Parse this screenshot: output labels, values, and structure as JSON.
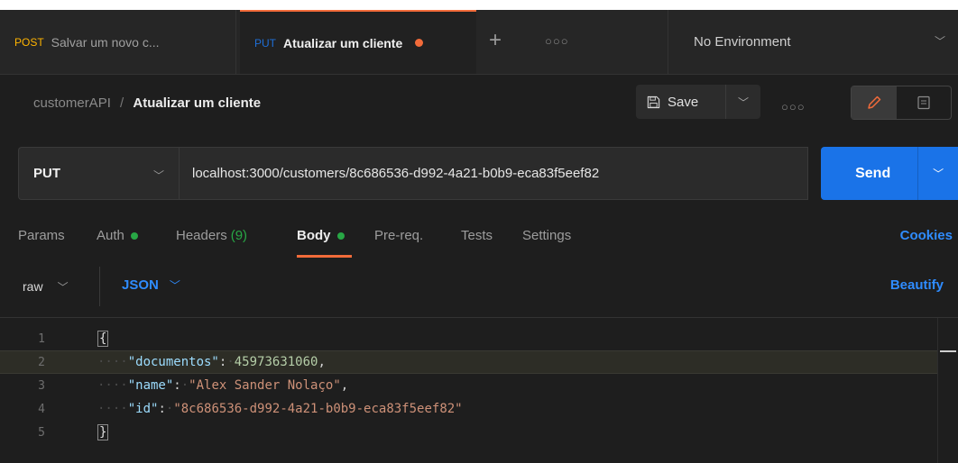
{
  "tabs": [
    {
      "method": "POST",
      "label": "Salvar um novo c..."
    },
    {
      "method": "PUT",
      "label": "Atualizar um cliente",
      "unsaved": true
    }
  ],
  "environment": "No Environment",
  "breadcrumb": {
    "collection": "customerAPI",
    "separator": "/",
    "request": "Atualizar um cliente"
  },
  "toolbar": {
    "save_label": "Save"
  },
  "request": {
    "method": "PUT",
    "url": "localhost:3000/customers/8c686536-d992-4a21-b0b9-eca83f5eef82",
    "send_label": "Send"
  },
  "request_tabs": {
    "params": "Params",
    "auth": "Auth",
    "headers": "Headers",
    "headers_count": "(9)",
    "body": "Body",
    "prereq": "Pre-req.",
    "tests": "Tests",
    "settings": "Settings",
    "cookies": "Cookies"
  },
  "body_options": {
    "mode": "raw",
    "language": "JSON",
    "beautify": "Beautify"
  },
  "editor": {
    "line_numbers": [
      "1",
      "2",
      "3",
      "4",
      "5"
    ],
    "lines": [
      {
        "open": "{"
      },
      {
        "key": "\"documentos\"",
        "value": "45973631060",
        "value_type": "number",
        "trail": ","
      },
      {
        "key": "\"name\"",
        "value": "\"Alex Sander Nolaço\"",
        "value_type": "string",
        "trail": ","
      },
      {
        "key": "\"id\"",
        "value": "\"8c686536-d992-4a21-b0b9-eca83f5eef82\"",
        "value_type": "string",
        "trail": ""
      },
      {
        "close": "}"
      }
    ]
  },
  "colors": {
    "accent": "#f26b3a",
    "send": "#1a73e8",
    "link": "#2f8cff",
    "ok": "#28a745",
    "put": "#1f6fd8",
    "post": "#ffb400"
  }
}
